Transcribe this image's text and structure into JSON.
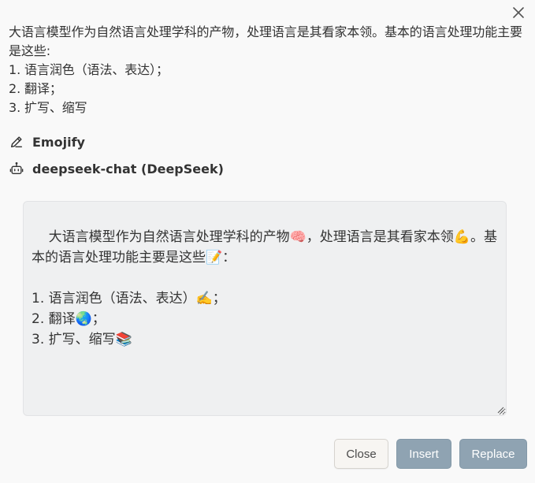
{
  "dialog": {
    "close_icon": "close-x-icon",
    "source_text": "大语言模型作为自然语言处理学科的产物，处理语言是其看家本领。基本的语言处理功能主要是这些:\n1. 语言润色（语法、表达）；\n2. 翻译；\n3. 扩写、缩写",
    "command": {
      "icon": "pencil-icon",
      "label": "Emojify"
    },
    "model": {
      "icon": "robot-icon",
      "label": "deepseek-chat (DeepSeek)"
    },
    "result_text": "大语言模型作为自然语言处理学科的产物🧠，处理语言是其看家本领💪。基本的语言处理功能主要是这些📝：\n\n1. 语言润色（语法、表达）✍️；\n2. 翻译🌏；\n3. 扩写、缩写📚",
    "buttons": {
      "close": "Close",
      "insert": "Insert",
      "replace": "Replace"
    },
    "colors": {
      "background": "#f9f9f9",
      "result_background": "#eff0f1",
      "primary_button": "#8fa3b2"
    }
  }
}
